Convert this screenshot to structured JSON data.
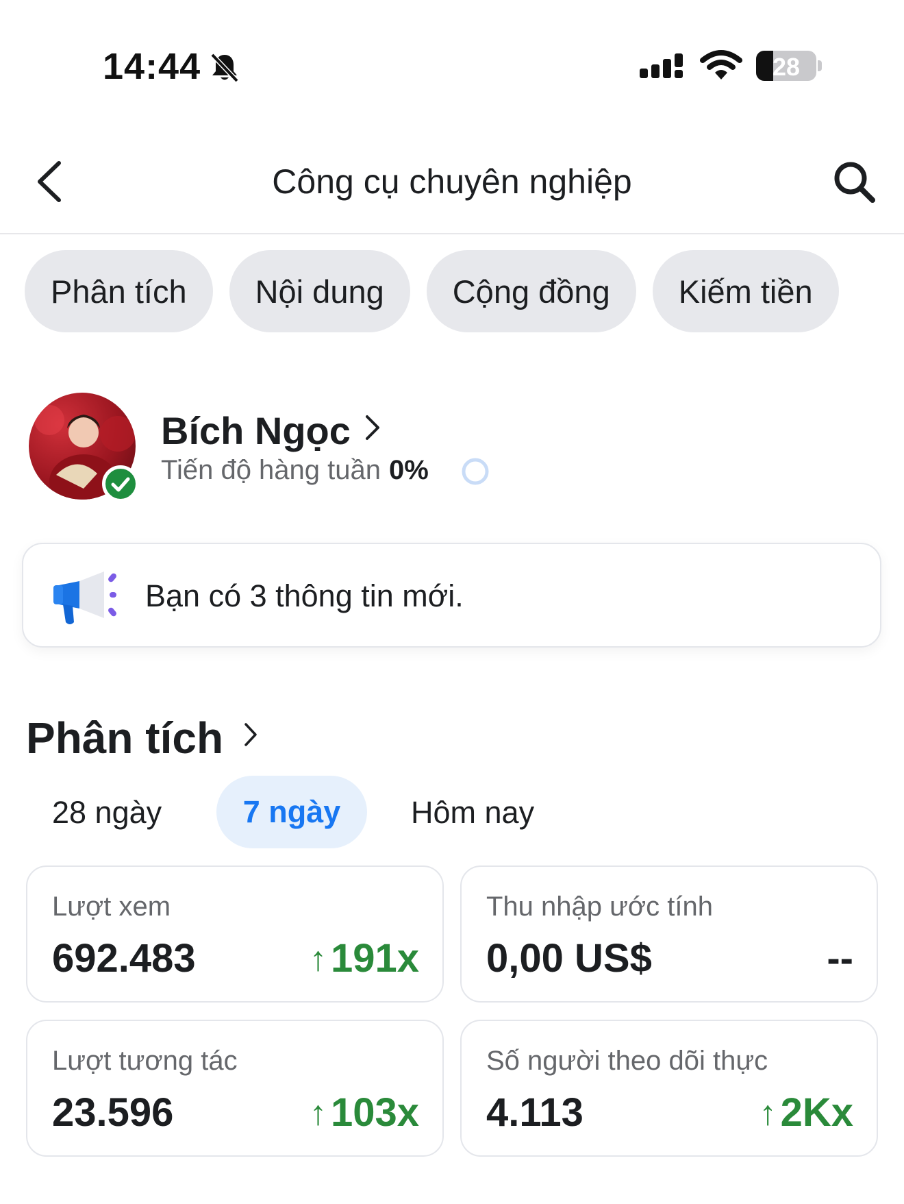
{
  "status_bar": {
    "time": "14:44",
    "battery_level": "28",
    "battery_fraction": 0.28
  },
  "header": {
    "title": "Công cụ chuyên nghiệp"
  },
  "tabs": [
    {
      "label": "Phân tích"
    },
    {
      "label": "Nội dung"
    },
    {
      "label": "Cộng đồng"
    },
    {
      "label": "Kiếm tiền"
    }
  ],
  "profile": {
    "name": "Bích Ngọc",
    "weekly_label": "Tiến độ hàng tuần",
    "weekly_value": "0%",
    "weekly_progress": 0
  },
  "notice": {
    "text": "Bạn có 3 thông tin mới."
  },
  "analytics": {
    "title": "Phân tích",
    "periods": [
      {
        "label": "28 ngày",
        "selected": false
      },
      {
        "label": "7 ngày",
        "selected": true
      },
      {
        "label": "Hôm nay",
        "selected": false
      }
    ],
    "cards": [
      {
        "label": "Lượt xem",
        "value": "692.483",
        "change": "191x",
        "trend": "up"
      },
      {
        "label": "Thu nhập ước tính",
        "value": "0,00 US$",
        "change": "--",
        "trend": "none"
      },
      {
        "label": "Lượt tương tác",
        "value": "23.596",
        "change": "103x",
        "trend": "up"
      },
      {
        "label": "Số người theo dõi thực",
        "value": "4.113",
        "change": "2Kx",
        "trend": "up"
      }
    ]
  },
  "colors": {
    "accent": "#1877f2",
    "positive": "#2a8a3a",
    "chip_bg": "#e7e8ec",
    "verified": "#1e8e3e"
  },
  "icons": {
    "back": "chevron-left-icon",
    "search": "search-icon",
    "bell": "bell-slash-icon",
    "notice": "megaphone-icon"
  }
}
